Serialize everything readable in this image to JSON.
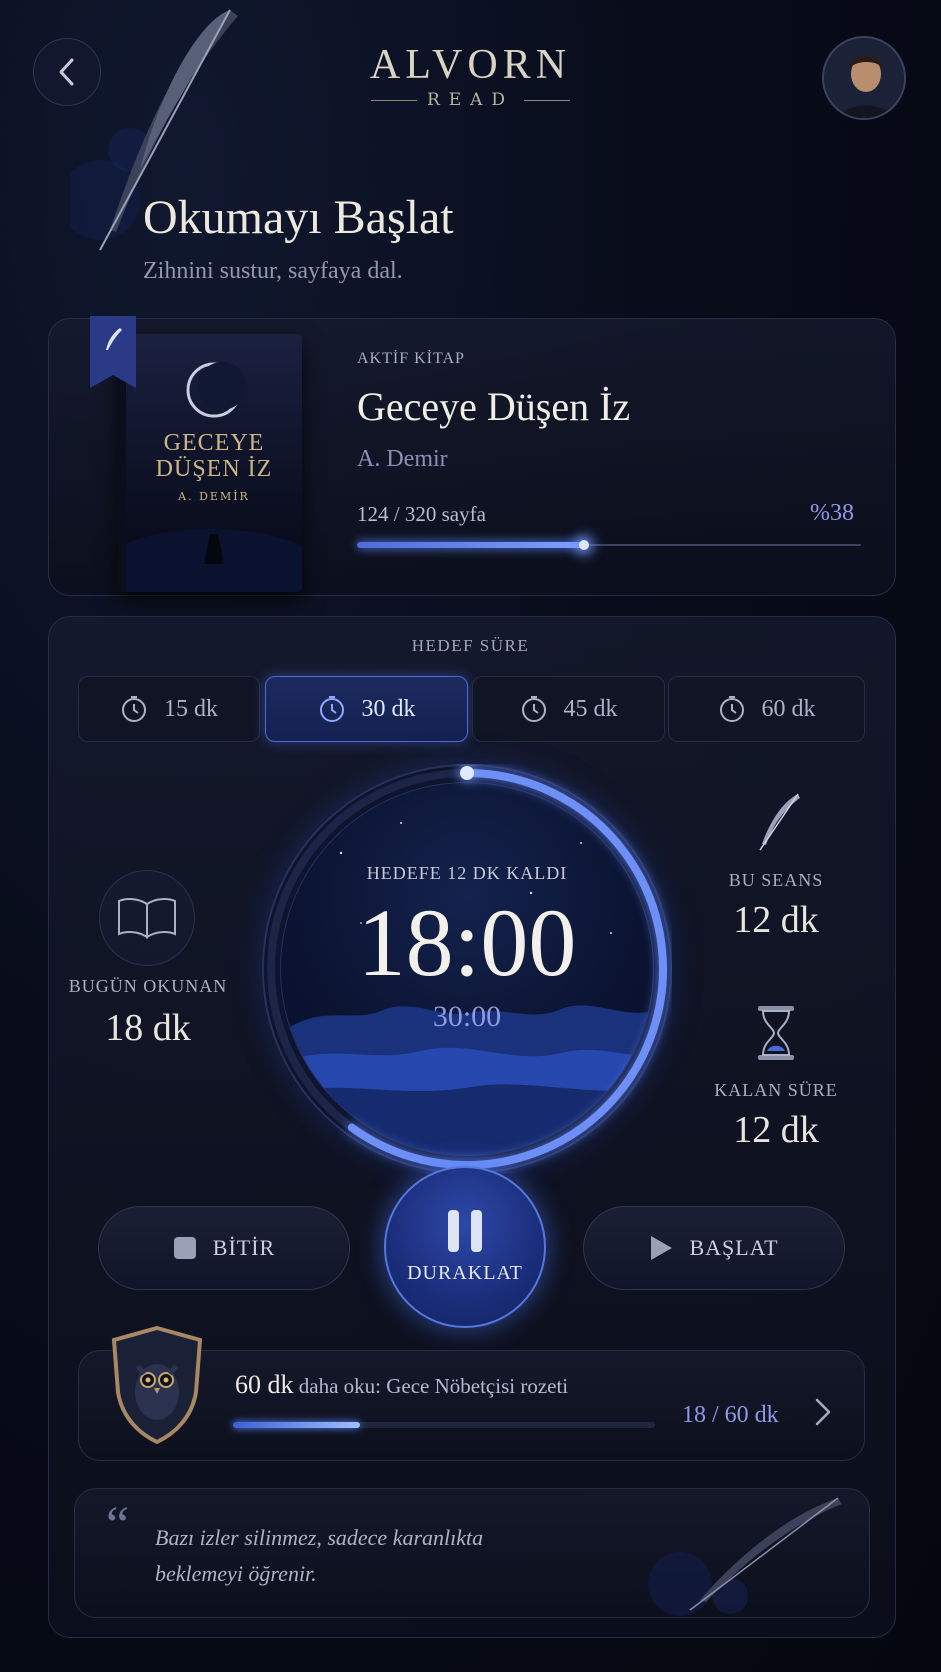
{
  "brand": {
    "name": "ALVORN",
    "sub": "READ"
  },
  "header": {
    "title": "Okumayı Başlat",
    "subtitle": "Zihnini sustur, sayfaya dal."
  },
  "book": {
    "label": "AKTİF KİTAP",
    "title": "Geceye Düşen İz",
    "author": "A. Demir",
    "cover_title_1": "GECEYE",
    "cover_title_2": "DÜŞEN İZ",
    "cover_author": "A. DEMİR",
    "pages": "124 / 320 sayfa",
    "percent_label": "%38",
    "progress": 0.45
  },
  "timer": {
    "target_label": "HEDEF SÜRE",
    "durations": [
      "15 dk",
      "30 dk",
      "45 dk",
      "60 dk"
    ],
    "selected_index": 1,
    "remaining_label": "HEDEFE 12 DK KALDI",
    "elapsed": "18:00",
    "total": "30:00",
    "progress": 0.6
  },
  "stats": {
    "today_label": "BUGÜN OKUNAN",
    "today_value": "18 dk",
    "session_label": "BU SEANS",
    "session_value": "12 dk",
    "remaining_label": "KALAN SÜRE",
    "remaining_value": "12 dk"
  },
  "controls": {
    "finish": "BİTİR",
    "pause": "DURAKLAT",
    "start": "BAŞLAT"
  },
  "badge": {
    "amount": "60 dk",
    "text": "daha oku: Gece Nöbetçisi rozeti",
    "count": "18 / 60 dk",
    "progress": 0.3
  },
  "quote": {
    "mark": "“",
    "line1": "Bazı izler silinmez, sadece karanlıkta",
    "line2": "beklemeyi öğrenir."
  },
  "colors": {
    "accent": "#5577e0",
    "accent_text": "#8f99e8",
    "background": "#080c1a"
  }
}
